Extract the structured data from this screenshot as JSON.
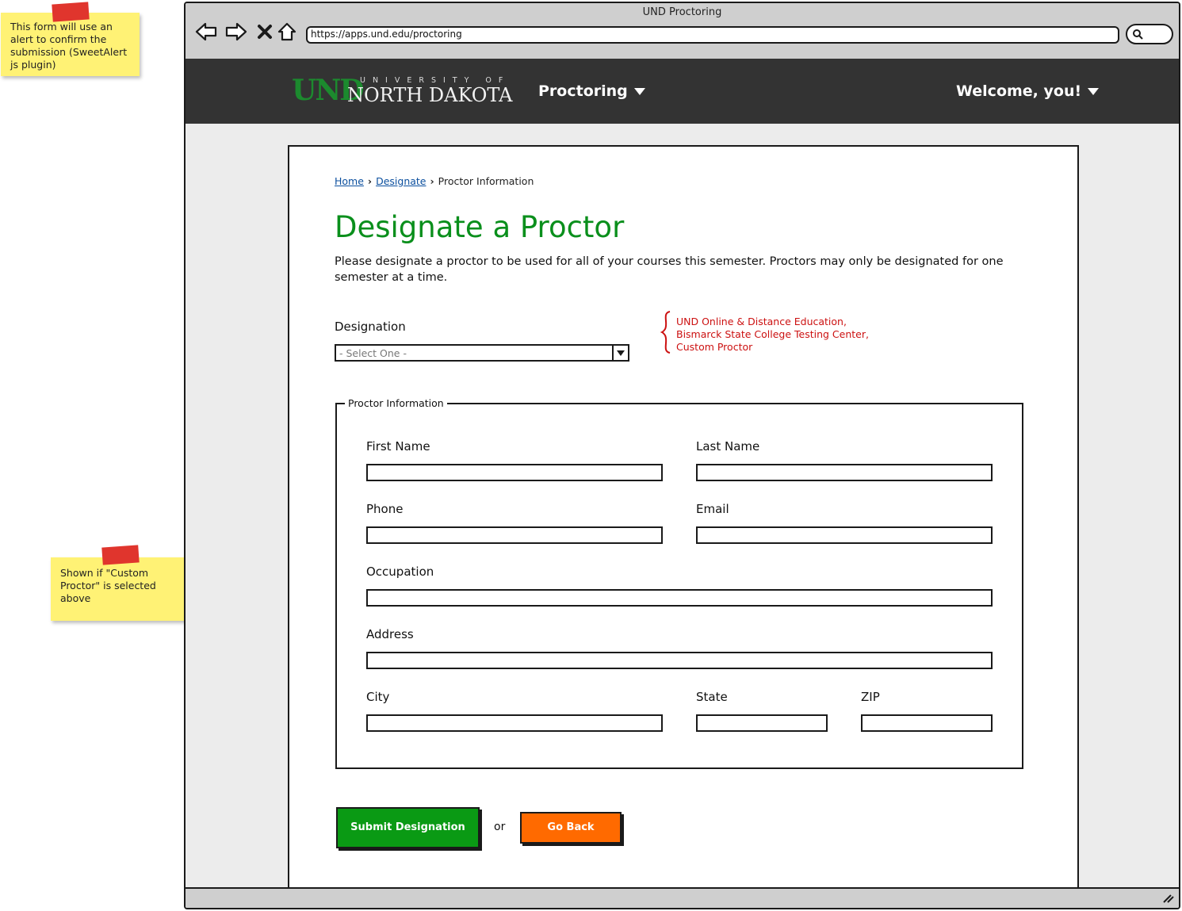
{
  "notes": {
    "alert_note": "This form will use an alert to confirm the submission (SweetAlert js plugin)",
    "custom_note": "Shown if \"Custom Proctor\" is selected above"
  },
  "browser": {
    "title": "UND Proctoring",
    "url": "https://apps.und.edu/proctoring"
  },
  "header": {
    "logo_mark": "UND",
    "logo_small": "UNIVERSITY OF",
    "logo_big": "NORTH DAKOTA",
    "nav_proctoring": "Proctoring",
    "nav_welcome": "Welcome, you!"
  },
  "breadcrumb": {
    "home": "Home",
    "designate": "Designate",
    "current": "Proctor Information"
  },
  "page": {
    "title": "Designate a Proctor",
    "intro": "Please designate a proctor to be used for all of your courses this semester. Proctors may only be designated for one semester at a time."
  },
  "designation": {
    "label": "Designation",
    "selected": "- Select One -",
    "options": [
      "UND Online & Distance Education,",
      "Bismarck State College Testing Center,",
      "Custom Proctor"
    ]
  },
  "proctor_info": {
    "legend": "Proctor Information",
    "first_name": "First Name",
    "last_name": "Last Name",
    "phone": "Phone",
    "email": "Email",
    "occupation": "Occupation",
    "address": "Address",
    "city": "City",
    "state": "State",
    "zip": "ZIP"
  },
  "actions": {
    "submit": "Submit Designation",
    "or": "or",
    "back": "Go Back"
  },
  "colors": {
    "header_bg": "#333333",
    "title_green": "#0a8f1c",
    "submit_green": "#0a9a14",
    "back_orange": "#ff6a00",
    "annotation_red": "#cc1111",
    "sticky_yellow": "#fff275"
  }
}
